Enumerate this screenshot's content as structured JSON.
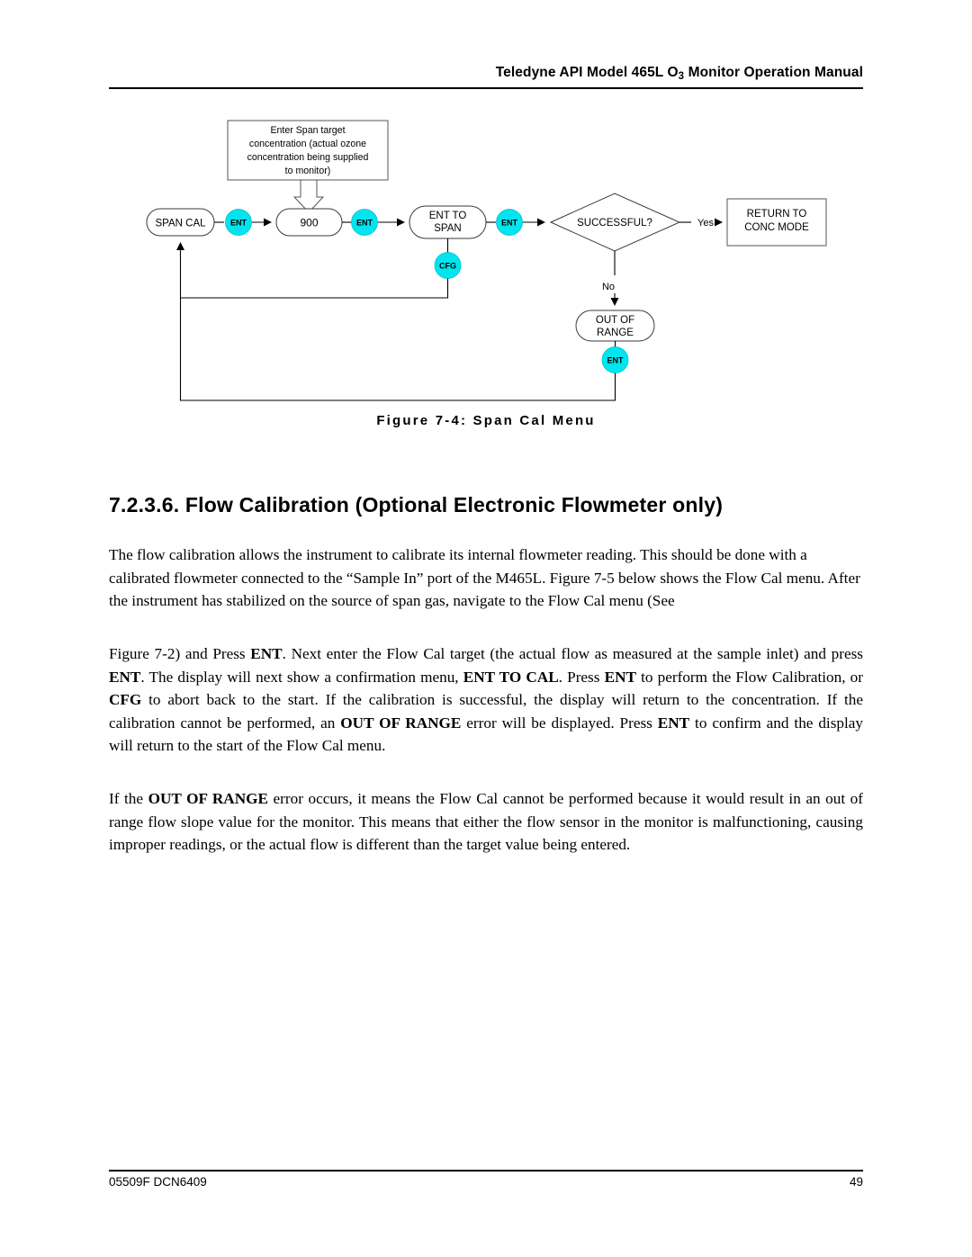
{
  "header": {
    "title_before": "Teledyne API Model 465L O",
    "title_sub": "3",
    "title_after": " Monitor Operation Manual"
  },
  "footer": {
    "doc_number": "05509F DCN6409",
    "page_number": "49"
  },
  "figure": {
    "caption": "Figure 7-4:  Span Cal Menu",
    "callout": {
      "line1": "Enter Span target",
      "line2": "concentration (actual ozone",
      "line3": "concentration being supplied",
      "line4": "to monitor)"
    },
    "nodes": {
      "span_cal": "SPAN CAL",
      "value": "900",
      "ent_to_span_line1": "ENT TO",
      "ent_to_span_line2": "SPAN",
      "decision": "SUCCESSFUL?",
      "return_line1": "RETURN TO",
      "return_line2": "CONC MODE",
      "out_of_range_line1": "OUT OF",
      "out_of_range_line2": "RANGE"
    },
    "keys": {
      "ent1": "ENT",
      "ent2": "ENT",
      "ent3": "ENT",
      "cfg": "CFG",
      "ent4": "ENT"
    },
    "edges": {
      "yes": "Yes",
      "no": "No"
    },
    "colors": {
      "key_fill": "#00E5EE",
      "line": "#000000",
      "shape_stroke": "#3a3a3a"
    }
  },
  "section": {
    "heading": "7.2.3.6. Flow Calibration (Optional Electronic Flowmeter only)",
    "paragraph1": "The flow calibration allows the instrument to calibrate its internal flowmeter reading.  This should be done with a calibrated flowmeter connected to the “Sample In” port of the M465L.  Figure 7-5 below shows the Flow Cal menu.  After the instrument has stabilized on the source of span gas, navigate to the Flow Cal menu (See",
    "paragraph2": {
      "t1": "Figure 7-2) and Press ",
      "b1": "ENT",
      "t2": ".  Next enter the Flow Cal target (the actual flow as measured at the sample inlet) and press ",
      "b2": "ENT",
      "t3": ".  The display will next show a confirmation menu, ",
      "b3": "ENT TO CAL",
      "t4": ".  Press ",
      "b4": "ENT",
      "t5": " to perform the Flow Calibration, or ",
      "b5": "CFG",
      "t6": " to abort back to the start.  If the calibration is successful, the display will return to the concentration.  If the calibration cannot be performed, an ",
      "b6": "OUT OF RANGE",
      "t7": " error will be displayed.  Press ",
      "b7": "ENT",
      "t8": " to confirm and the display will return to the start of the Flow Cal menu."
    },
    "paragraph3": {
      "t1": "If the ",
      "b1": "OUT OF RANGE",
      "t2": " error occurs, it means the Flow Cal cannot be performed because it would result in an out of range flow slope value for the monitor.  This means that either the flow sensor in the monitor is malfunctioning, causing improper readings, or the actual flow is different than the target value being entered."
    }
  }
}
